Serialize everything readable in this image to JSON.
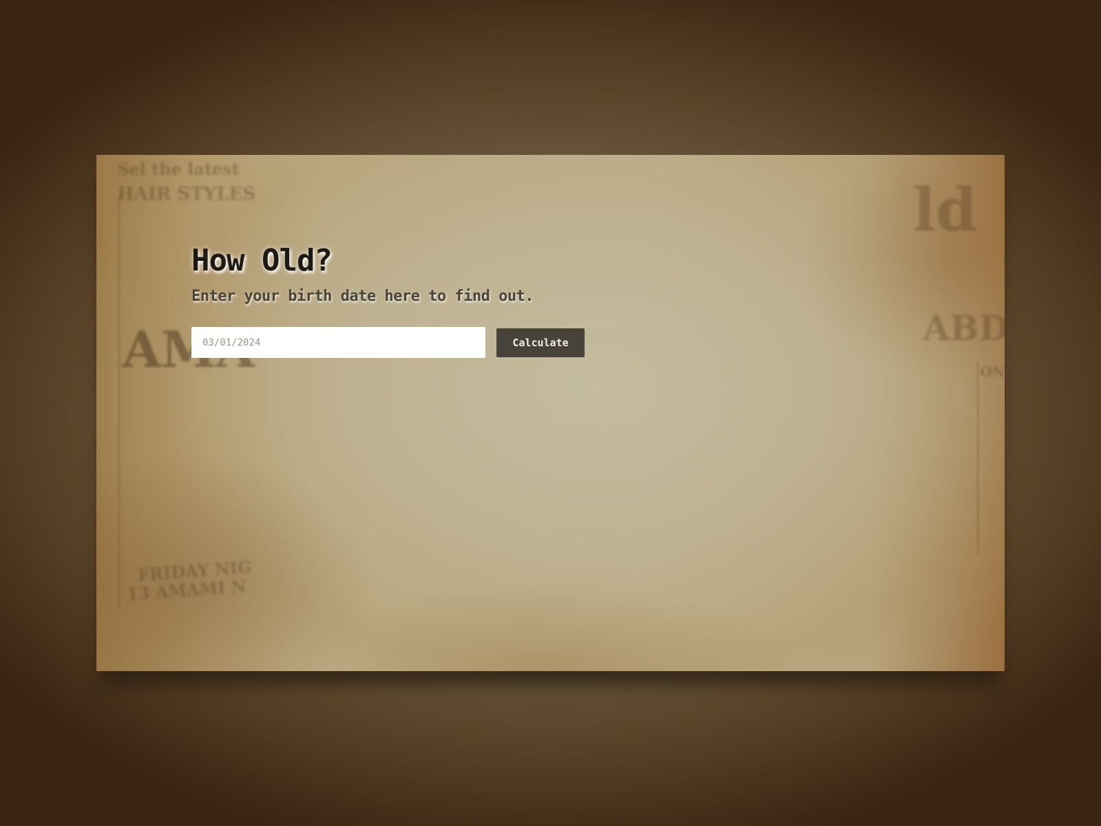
{
  "page": {
    "title": "How Old?",
    "subtitle": "Enter your birth date here to find out."
  },
  "form": {
    "date_value": "03/01/2024",
    "button_label": "Calculate"
  },
  "background_text": {
    "top_left_1": "Sel the latest",
    "top_left_2": "HAIR STYLES",
    "left_big": "AMA",
    "left_bottom_1": "FRIDAY NIG",
    "left_bottom_2": "13 AMAMI N",
    "right_big": "ld",
    "right_mid": "ABD",
    "right_small": "ON"
  },
  "colors": {
    "button_bg": "#48433a",
    "button_text": "#f2ede2",
    "title_text": "#1d1a15",
    "subtitle_text": "#4b4538"
  }
}
